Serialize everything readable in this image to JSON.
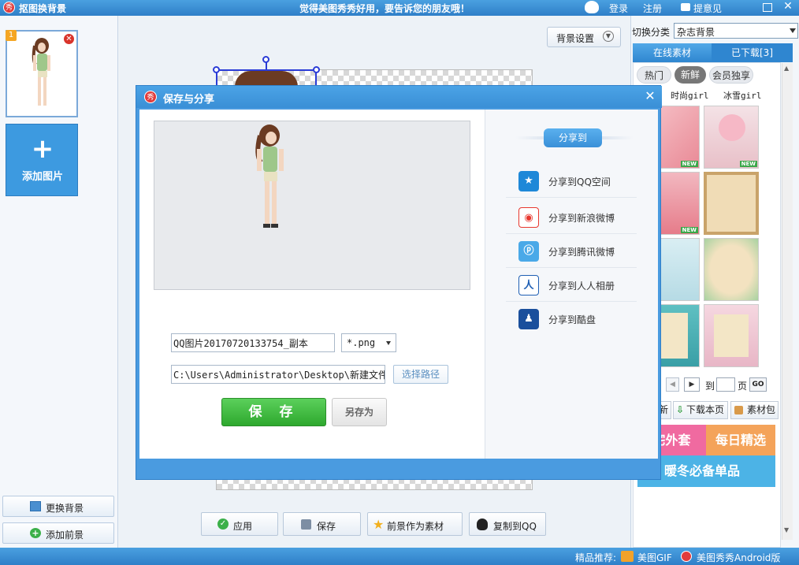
{
  "titlebar": {
    "logo": "秀",
    "app_title": "抠图换背景",
    "slogan": "觉得美图秀秀好用，要告诉您的朋友哦！",
    "login": "登录",
    "register": "注册",
    "feedback": "提意见"
  },
  "left": {
    "thumb_index": "1",
    "add_image": "添加图片",
    "change_bg": "更换背景",
    "add_fg": "添加前景"
  },
  "center": {
    "bg_settings": "背景设置",
    "apply": "应用",
    "save": "保存",
    "as_material": "前景作为素材",
    "copy_qq": "复制到QQ"
  },
  "right": {
    "switch_category_label": "切换分类",
    "category_value": "杂志背景",
    "tab_online": "在线素材",
    "tab_downloaded": "已下载[3]",
    "filter_hot": "热门",
    "filter_new": "新鲜",
    "filter_vip": "会员独享",
    "sub_tag_1": "时尚girl",
    "sub_tag_2": "冰雪girl",
    "new_badge": "NEW",
    "goto_label": "到",
    "page_label": "页",
    "go": "GO",
    "refresh_short": "新",
    "download_page": "下载本页",
    "material_pack": "素材包",
    "promo_1": "宅外套",
    "promo_2": "每日精选",
    "promo_3": "暖冬必备单品"
  },
  "bottombar": {
    "recommend": "精品推荐:",
    "gif": "美图GIF",
    "android": "美图秀秀Android版"
  },
  "modal": {
    "logo": "秀",
    "title": "保存与分享",
    "filename": "QQ图片20170720133754_副本",
    "ext": "*.png",
    "path": "C:\\Users\\Administrator\\Desktop\\新建文件",
    "choose_path": "选择路径",
    "save": "保 存",
    "save_as": "另存为",
    "share_to": "分享到",
    "share_items": [
      {
        "label": "分享到QQ空间",
        "icon": "qzone-icon",
        "color": "#1e88d8"
      },
      {
        "label": "分享到新浪微博",
        "icon": "weibo-icon",
        "color": "#e8382f"
      },
      {
        "label": "分享到腾讯微博",
        "icon": "tencent-weibo-icon",
        "color": "#4aa9e8"
      },
      {
        "label": "分享到人人相册",
        "icon": "renren-icon",
        "color": "#1f5fb4"
      },
      {
        "label": "分享到酷盘",
        "icon": "kupan-icon",
        "color": "#1a6fc8"
      }
    ]
  },
  "colors": {
    "accent": "#3a8fd6",
    "save_green": "#2ea82e",
    "promo_pink": "#f06aa0",
    "promo_orange": "#f4a35a",
    "promo_blue": "#4cb3e6"
  }
}
